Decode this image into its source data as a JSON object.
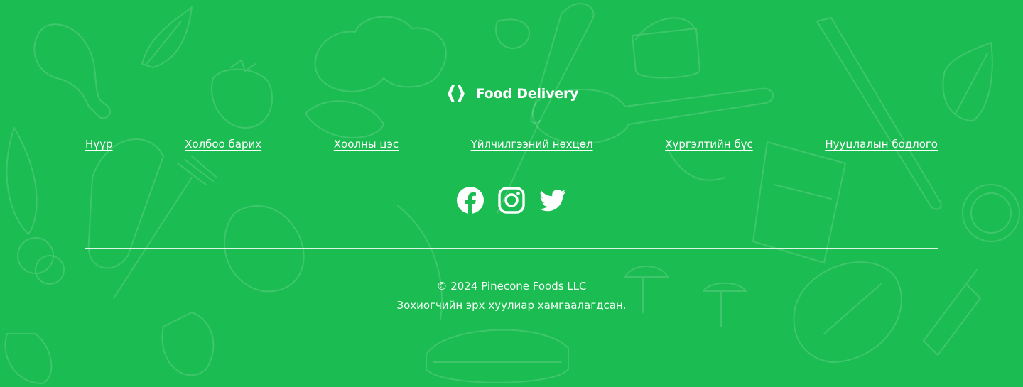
{
  "brand": {
    "name": "Food Delivery"
  },
  "nav": {
    "items": [
      {
        "label": "Нүүр"
      },
      {
        "label": "Холбоо барих"
      },
      {
        "label": "Хоолны цэс"
      },
      {
        "label": "Үйлчилгээний нөхцөл"
      },
      {
        "label": "Хүргэлтийн бүс"
      },
      {
        "label": "Нууцлалын бодлого"
      }
    ]
  },
  "social": {
    "icons": [
      "facebook-icon",
      "instagram-icon",
      "twitter-icon"
    ]
  },
  "footer": {
    "copyright": "© 2024 Pinecone Foods LLC",
    "rights": "Зохиогчийн эрх хуулиар хамгаалагдсан."
  },
  "colors": {
    "background": "#1bbc51",
    "text": "#ffffff"
  }
}
